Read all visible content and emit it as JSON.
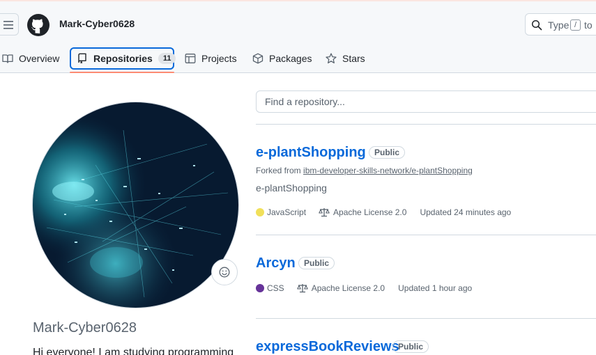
{
  "header": {
    "username": "Mark-Cyber0628",
    "search_text": "Type",
    "search_key": "/",
    "search_text_after": "to"
  },
  "tabs": [
    {
      "label": "Overview"
    },
    {
      "label": "Repositories",
      "count": "11"
    },
    {
      "label": "Projects"
    },
    {
      "label": "Packages"
    },
    {
      "label": "Stars"
    }
  ],
  "profile": {
    "name": "Mark-Cyber0628",
    "bio": "Hi everyone! I am studying programming"
  },
  "find": {
    "placeholder": "Find a repository..."
  },
  "repos": [
    {
      "name": "e-plantShopping",
      "visibility": "Public",
      "forked_prefix": "Forked from",
      "forked_from": "ibm-developer-skills-network/e-plantShopping",
      "description": "e-plantShopping",
      "language": "JavaScript",
      "language_color": "#f1e05a",
      "license": "Apache License 2.0",
      "updated": "Updated 24 minutes ago"
    },
    {
      "name": "Arcyn",
      "visibility": "Public",
      "language": "CSS",
      "language_color": "#663399",
      "license": "Apache License 2.0",
      "updated": "Updated 1 hour ago"
    },
    {
      "name": "expressBookReviews",
      "visibility": "Public"
    }
  ],
  "colors": {
    "accent": "#0969da",
    "tab_underline": "#fd8c73",
    "border": "#d1d9e0"
  }
}
